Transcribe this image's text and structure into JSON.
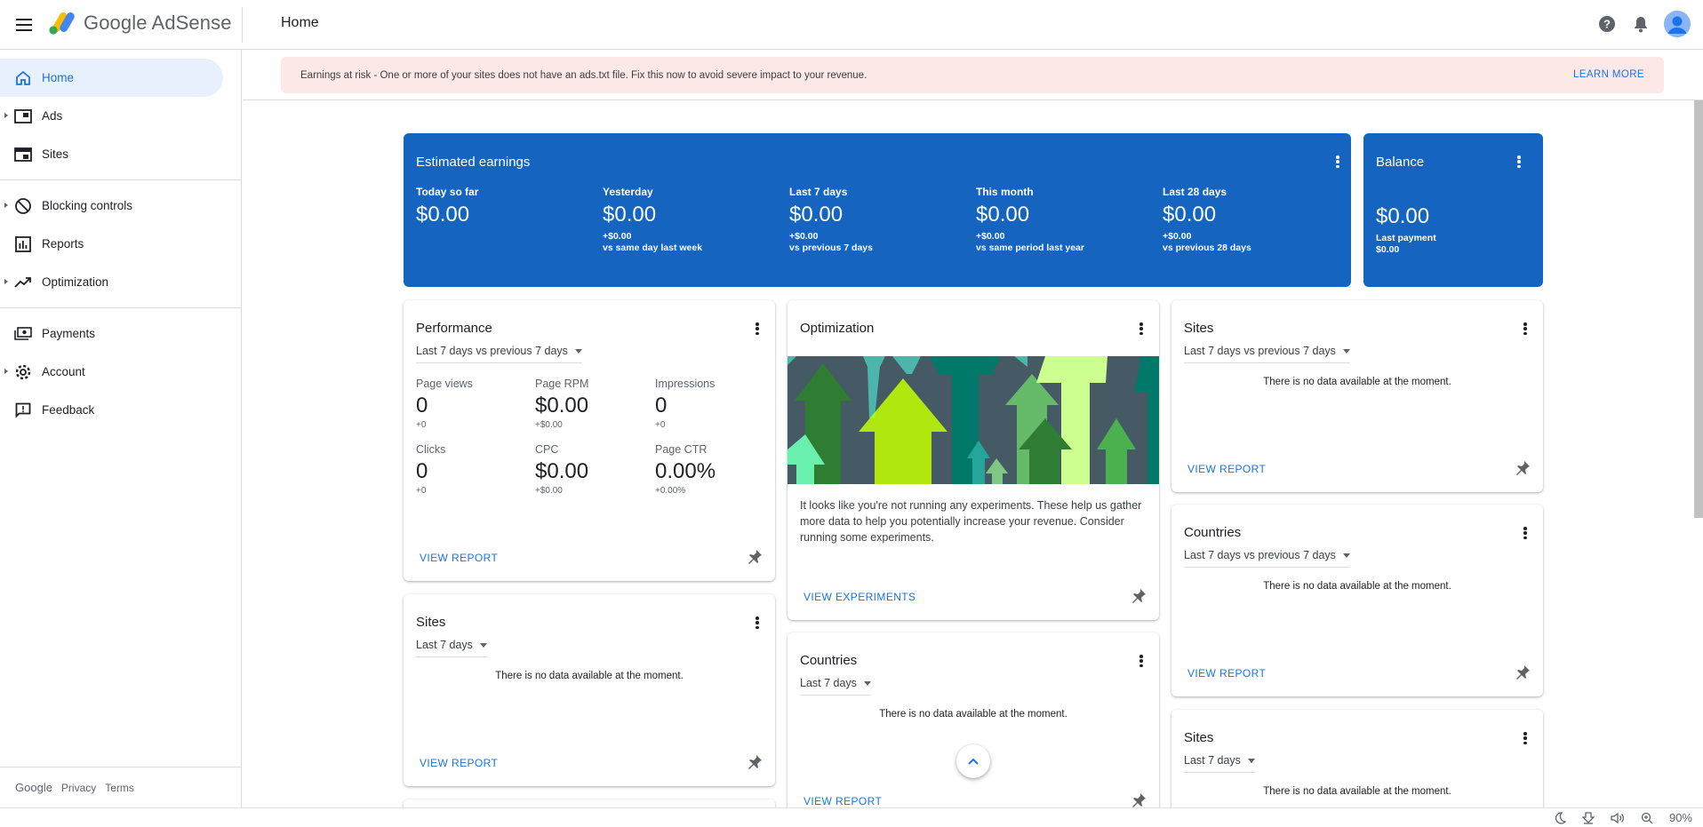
{
  "app": {
    "product": "Google AdSense",
    "page_title": "Home"
  },
  "sidebar": {
    "items": [
      {
        "label": "Home",
        "icon": "home-icon",
        "active": true
      },
      {
        "label": "Ads",
        "icon": "ads-icon",
        "expandable": true
      },
      {
        "label": "Sites",
        "icon": "sites-icon"
      },
      {
        "label": "Blocking controls",
        "icon": "block-icon",
        "expandable": true
      },
      {
        "label": "Reports",
        "icon": "reports-icon"
      },
      {
        "label": "Optimization",
        "icon": "trending-icon",
        "expandable": true
      },
      {
        "label": "Payments",
        "icon": "payments-icon"
      },
      {
        "label": "Account",
        "icon": "gear-icon",
        "expandable": true
      },
      {
        "label": "Feedback",
        "icon": "feedback-icon"
      }
    ],
    "footer": {
      "google": "Google",
      "privacy": "Privacy",
      "terms": "Terms"
    }
  },
  "alert": {
    "text": "Earnings at risk - One or more of your sites does not have an ads.txt file. Fix this now to avoid severe impact to your revenue.",
    "action": "LEARN MORE"
  },
  "earnings": {
    "title": "Estimated earnings",
    "columns": [
      {
        "label": "Today so far",
        "value": "$0.00",
        "delta": "",
        "compare": ""
      },
      {
        "label": "Yesterday",
        "value": "$0.00",
        "delta": "+$0.00",
        "compare": "vs same day last week"
      },
      {
        "label": "Last 7 days",
        "value": "$0.00",
        "delta": "+$0.00",
        "compare": "vs previous 7 days"
      },
      {
        "label": "This month",
        "value": "$0.00",
        "delta": "+$0.00",
        "compare": "vs same period last year"
      },
      {
        "label": "Last 28 days",
        "value": "$0.00",
        "delta": "+$0.00",
        "compare": "vs previous 28 days"
      }
    ]
  },
  "balance": {
    "title": "Balance",
    "value": "$0.00",
    "last_payment_label": "Last payment",
    "last_payment_value": "$0.00"
  },
  "performance": {
    "title": "Performance",
    "range": "Last 7 days vs previous 7 days",
    "metrics": [
      {
        "label": "Page views",
        "value": "0",
        "delta": "+0"
      },
      {
        "label": "Page RPM",
        "value": "$0.00",
        "delta": "+$0.00"
      },
      {
        "label": "Impressions",
        "value": "0",
        "delta": "+0"
      },
      {
        "label": "Clicks",
        "value": "0",
        "delta": "+0"
      },
      {
        "label": "CPC",
        "value": "$0.00",
        "delta": "+$0.00"
      },
      {
        "label": "Page CTR",
        "value": "0.00%",
        "delta": "+0.00%"
      }
    ],
    "link": "VIEW REPORT"
  },
  "optimization": {
    "title": "Optimization",
    "text": "It looks like you're not running any experiments. These help us gather more data to help you potentially increase your revenue. Consider running some experiments.",
    "link": "VIEW EXPERIMENTS"
  },
  "nodata": "There is no data available at the moment.",
  "cards": {
    "sites_left": {
      "title": "Sites",
      "range": "Last 7 days",
      "link": "VIEW REPORT"
    },
    "countries_mid": {
      "title": "Countries",
      "range": "Last 7 days",
      "link": "VIEW REPORT"
    },
    "sites_right": {
      "title": "Sites",
      "range": "Last 7 days vs previous 7 days",
      "link": "VIEW REPORT"
    },
    "countries_right": {
      "title": "Countries",
      "range": "Last 7 days vs previous 7 days",
      "link": "VIEW REPORT"
    },
    "sites_right2": {
      "title": "Sites",
      "range": "Last 7 days"
    }
  },
  "statusbar": {
    "zoom": "90%"
  },
  "colors": {
    "accent": "#1a73e8",
    "earnings_bg": "#1565c0",
    "alert_bg": "#fce8e6",
    "active_nav_bg": "#e8f0fe"
  }
}
